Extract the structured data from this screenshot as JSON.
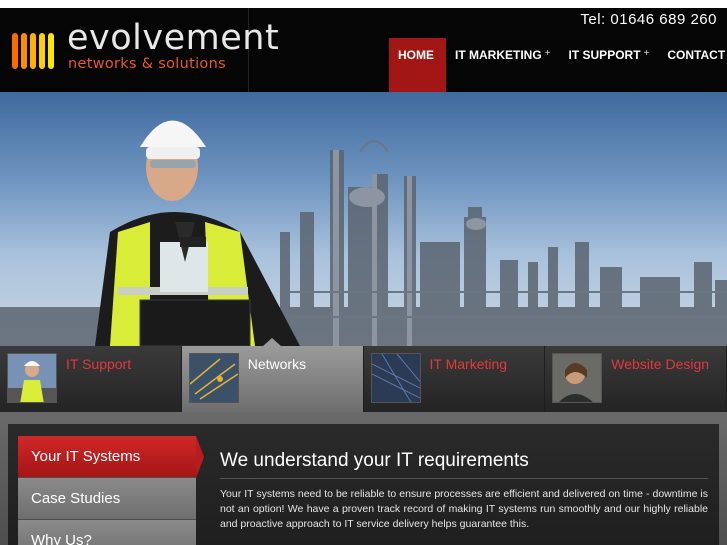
{
  "header": {
    "logo": {
      "wordmark": "evolvement",
      "tagline": "networks & solutions",
      "bar_colors": [
        "#ff6a00",
        "#ff8c00",
        "#ffb000",
        "#ffd000",
        "#ffe600"
      ]
    },
    "phone": "Tel: 01646 689 260"
  },
  "nav": {
    "items": [
      {
        "label": "HOME",
        "plus": "",
        "active": true
      },
      {
        "label": "IT MARKETING",
        "plus": "+",
        "active": false
      },
      {
        "label": "IT SUPPORT",
        "plus": "+",
        "active": false
      },
      {
        "label": "CONTACT",
        "plus": "+",
        "active": false
      }
    ]
  },
  "hero": {
    "alt_subject": "worker-in-hard-hat-with-laptop"
  },
  "tabs": [
    {
      "label": "IT Support",
      "thumb": "worker-thumb",
      "active": false
    },
    {
      "label": "Networks",
      "thumb": "circuit-thumb",
      "active": true
    },
    {
      "label": "IT Marketing",
      "thumb": "screen-thumb",
      "active": false
    },
    {
      "label": "Website Design",
      "thumb": "person-thumb",
      "active": false
    }
  ],
  "side_menu": {
    "items": [
      {
        "label": "Your IT Systems",
        "active": true
      },
      {
        "label": "Case Studies",
        "active": false
      },
      {
        "label": "Why Us?",
        "active": false
      }
    ]
  },
  "content": {
    "title": "We understand your IT requirements",
    "body": "Your IT systems need to be reliable to ensure processes are efficient and delivered on time - downtime is not an option! We have a proven track record of making IT systems run smoothly and our highly reliable and proactive approach to IT service delivery helps guarantee this."
  },
  "colors": {
    "accent_red": "#a31616",
    "tab_label_red": "#e03a3a",
    "header_bg": "#050505",
    "logo_orange": "#e85a1f"
  }
}
